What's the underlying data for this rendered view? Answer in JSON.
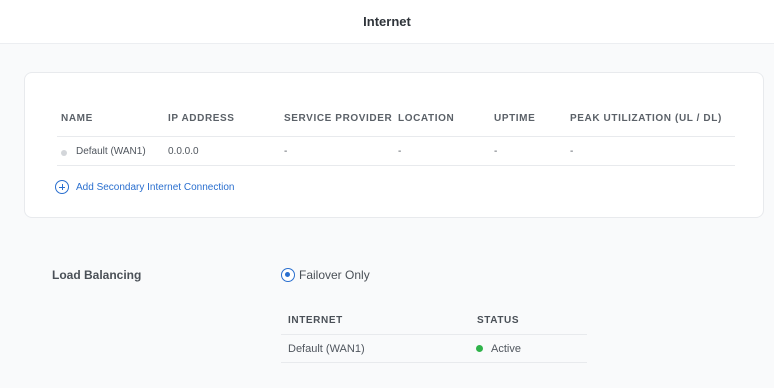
{
  "header": {
    "title": "Internet"
  },
  "wan_table": {
    "columns": [
      "NAME",
      "IP ADDRESS",
      "SERVICE PROVIDER",
      "LOCATION",
      "UPTIME",
      "PEAK UTILIZATION (UL / DL)"
    ],
    "rows": [
      {
        "name": "Default (WAN1)",
        "ip": "0.0.0.0",
        "provider": "-",
        "location": "-",
        "uptime": "-",
        "peak": "-",
        "status_color": "#d3d6da"
      }
    ],
    "add_link": "Add Secondary Internet Connection"
  },
  "load_balancing": {
    "label": "Load Balancing",
    "mode": "Failover Only",
    "columns": [
      "INTERNET",
      "STATUS"
    ],
    "rows": [
      {
        "internet": "Default (WAN1)",
        "status": "Active",
        "status_color": "#2fb34a"
      }
    ]
  },
  "colors": {
    "accent": "#2a6fcf",
    "active": "#2fb34a"
  }
}
